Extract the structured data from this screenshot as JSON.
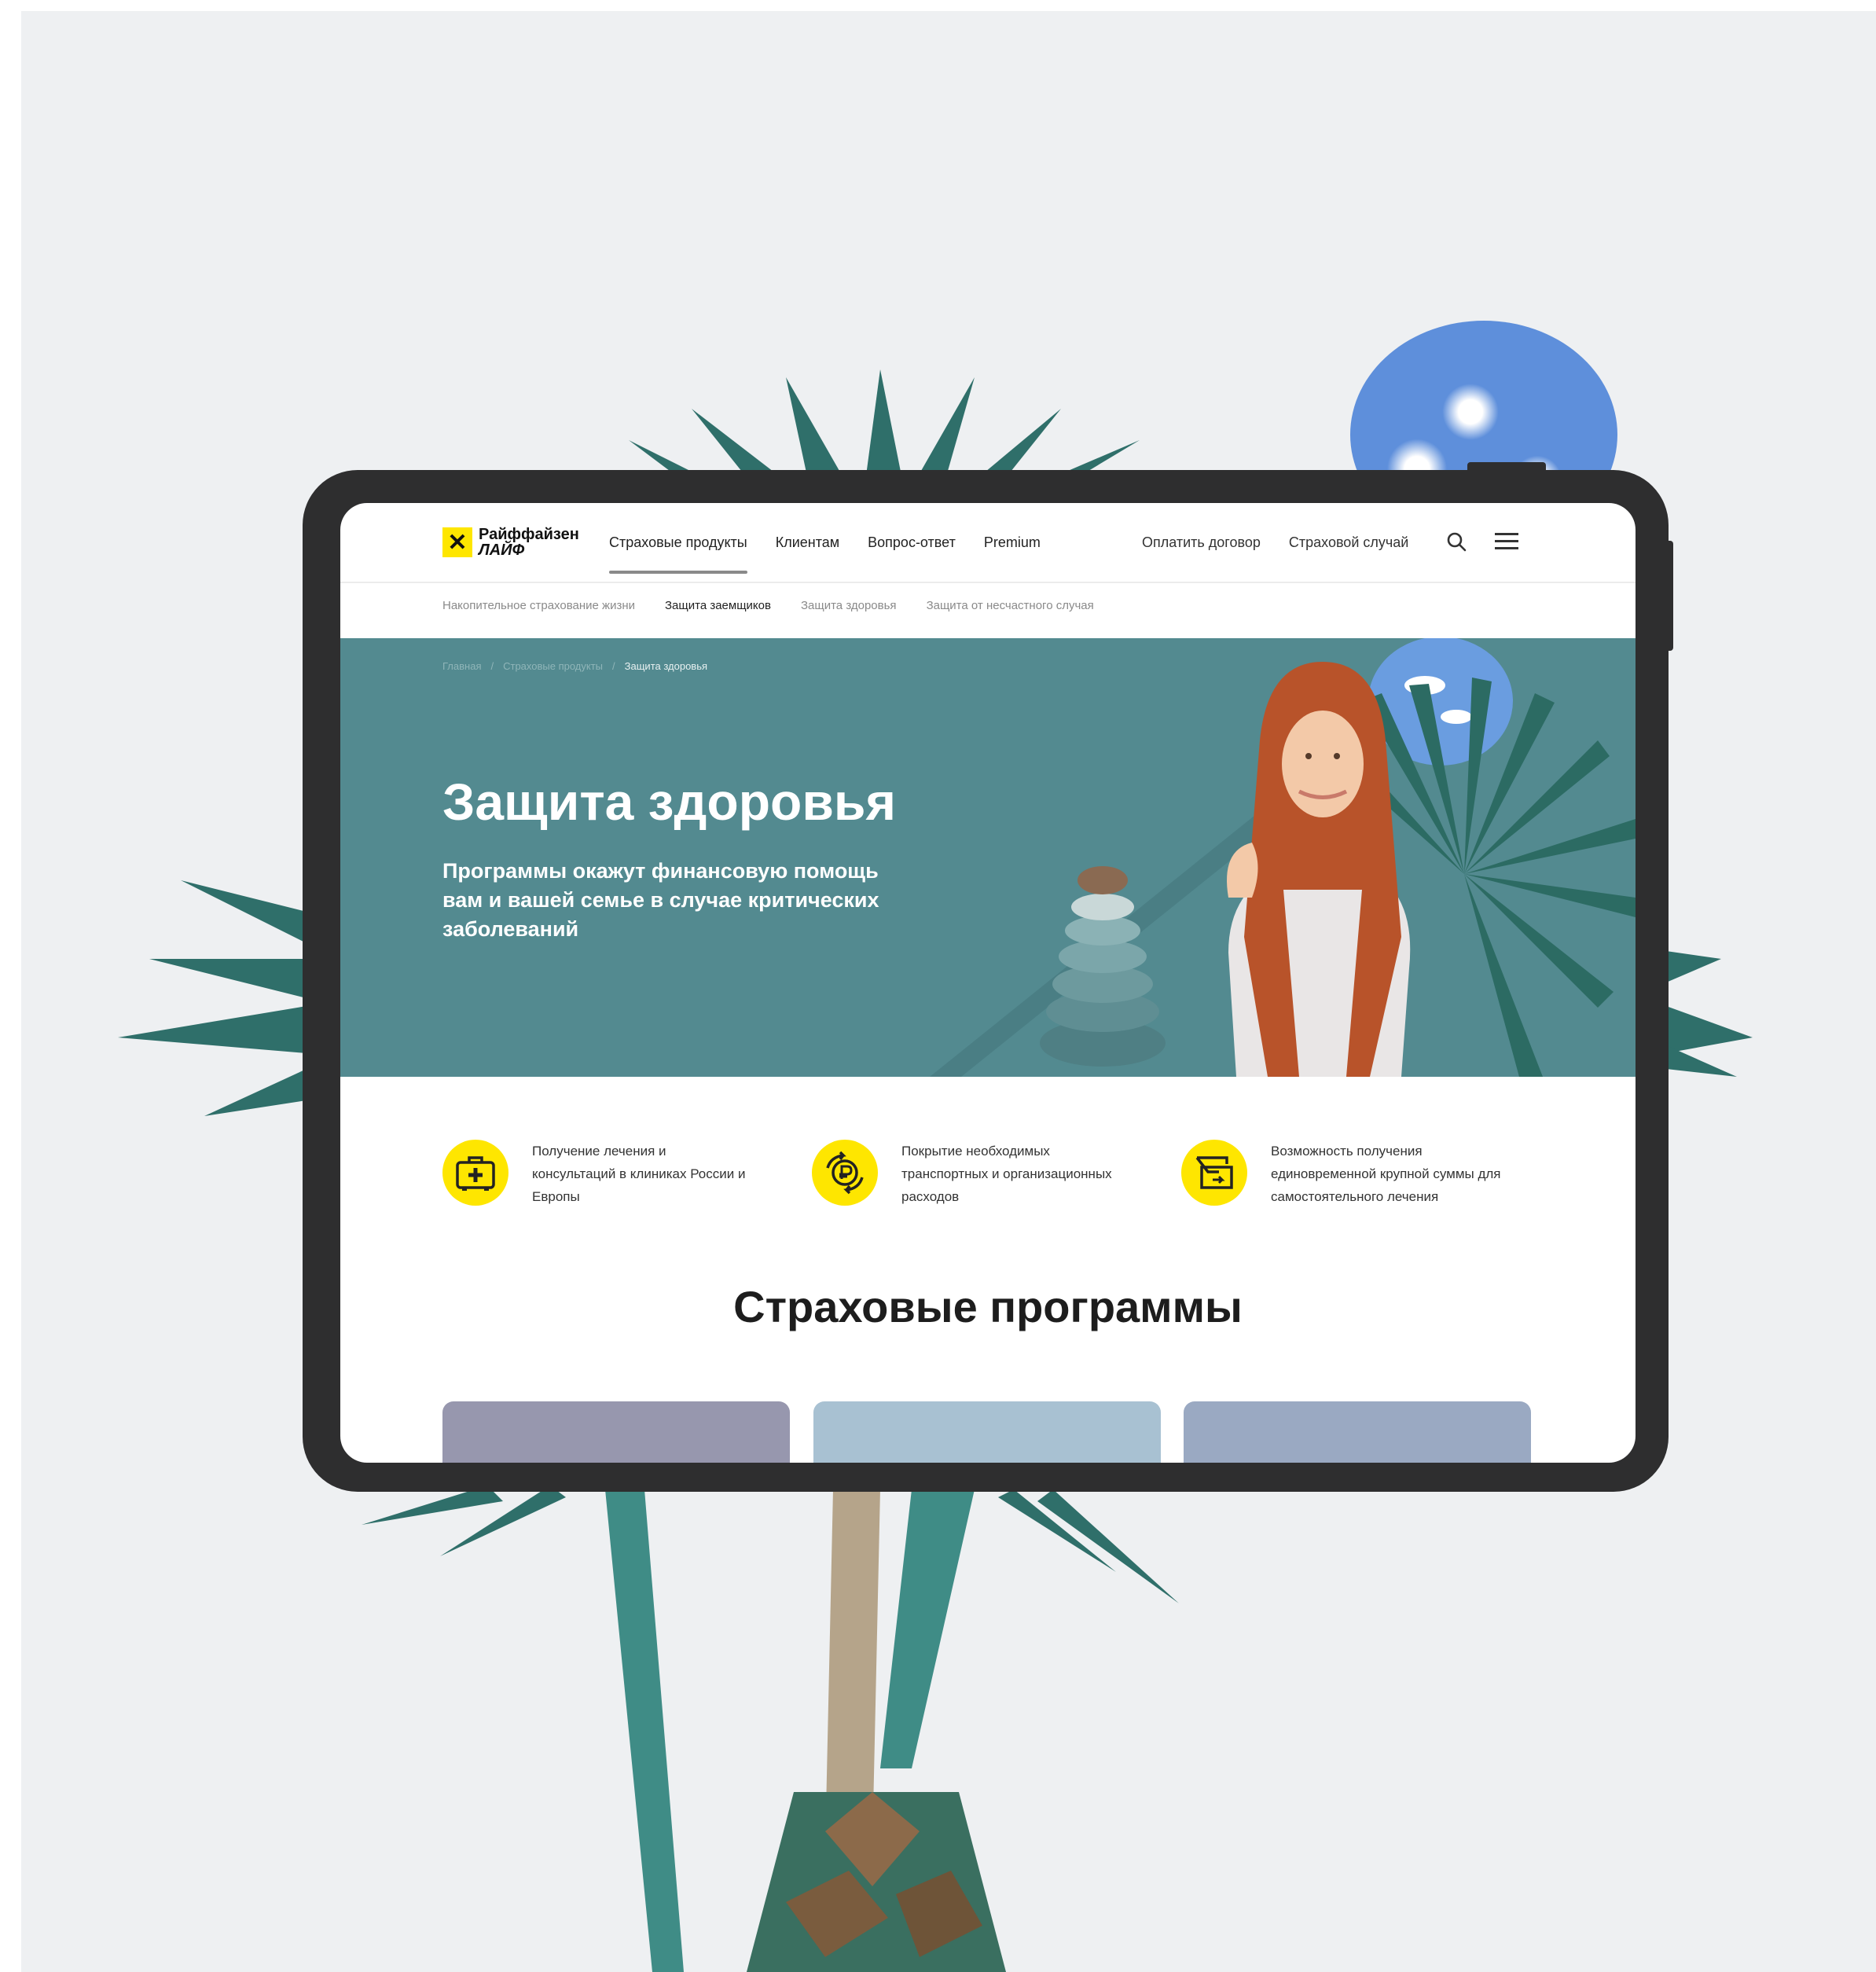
{
  "header": {
    "logo_line1": "Райффайзен",
    "logo_line2": "ЛАЙФ",
    "nav": [
      "Страховые продукты",
      "Клиентам",
      "Вопрос-ответ",
      "Premium"
    ],
    "nav_right": [
      "Оплатить договор",
      "Страховой случай"
    ]
  },
  "subnav": [
    "Накопительное страхование жизни",
    "Защита заемщиков",
    "Защита здоровья",
    "Защита от несчастного случая"
  ],
  "breadcrumbs": [
    "Главная",
    "/",
    "Страховые продукты",
    "/",
    "Защита здоровья"
  ],
  "hero": {
    "title": "Защита здоровья",
    "subtitle": "Программы окажут финансовую помощь вам и вашей семье в случае критических заболеваний"
  },
  "features": [
    {
      "icon": "first-aid-kit-icon",
      "text": "Получение лечения и консультаций в клиниках России и Европы"
    },
    {
      "icon": "ruble-exchange-icon",
      "text": "Покрытие необходимых транспортных и организационных расходов"
    },
    {
      "icon": "money-transfer-icon",
      "text": "Возможность получения единовременной крупной суммы для самостоятельного лечения"
    }
  ],
  "programs": {
    "title": "Страховые программы",
    "card_colors": [
      "#9797ae",
      "#a8c1d2",
      "#9aa9c2"
    ]
  },
  "colors": {
    "brand_yellow": "#fee600",
    "hero_teal": "#538a90",
    "tablet_frame": "#2e2e2f"
  }
}
